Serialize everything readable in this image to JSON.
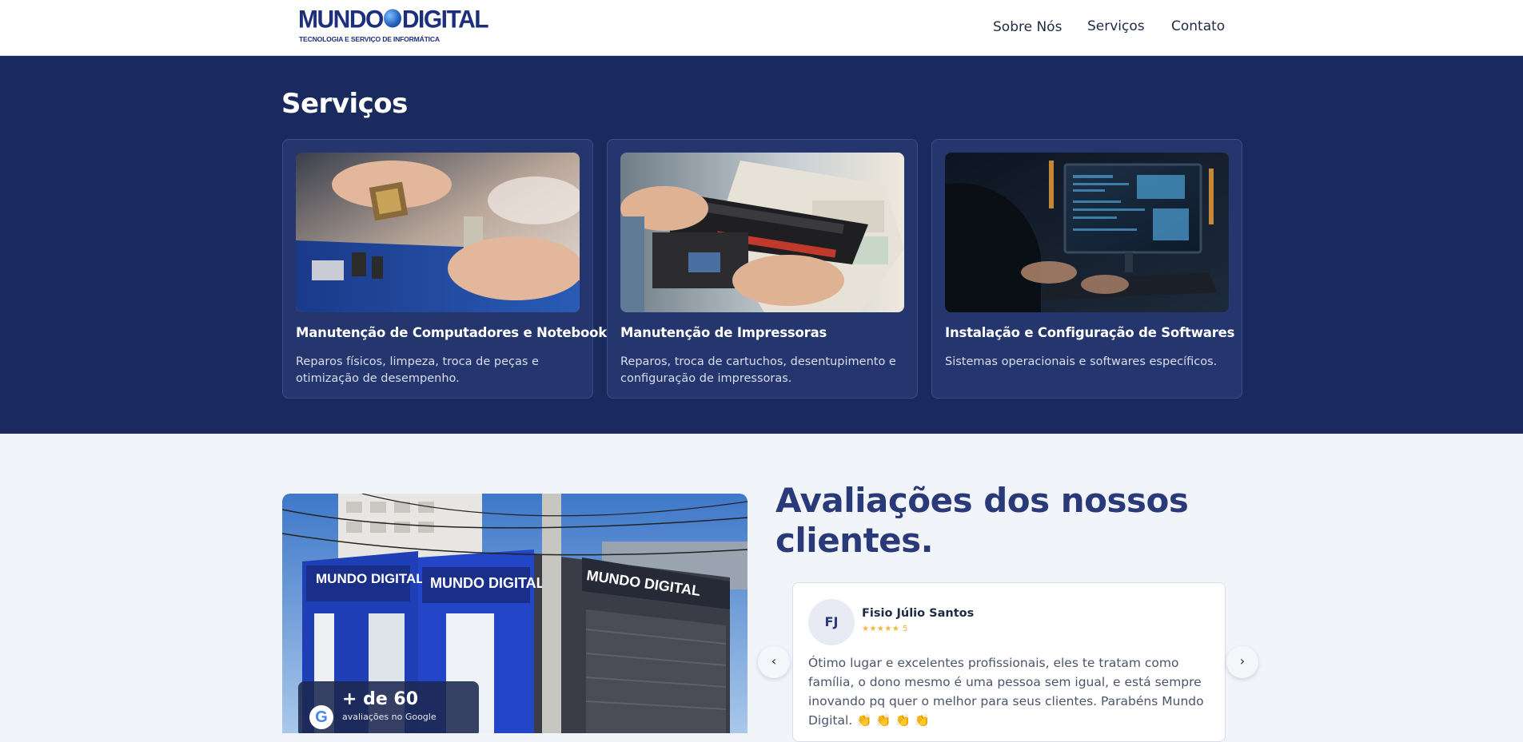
{
  "header": {
    "logo_main": "MUNDO DIGITAL",
    "logo_sub": "TECNOLOGIA E SERVIÇO DE INFORMÁTICA",
    "nav": [
      "Sobre Nós",
      "Serviços",
      "Contato"
    ]
  },
  "services": {
    "title": "Serviços",
    "cards": [
      {
        "title": "Manutenção de Computadores e Notebooks",
        "description": "Reparos físicos, limpeza, troca de peças e otimização de desempenho.",
        "image": "hands-cpu-motherboard-photo"
      },
      {
        "title": "Manutenção de Impressoras",
        "description": "Reparos, troca de cartuchos, desentupimento e configuração de impressoras.",
        "image": "hands-printer-toner-photo"
      },
      {
        "title": "Instalação e Configuração de Softwares",
        "description": "Sistemas operacionais e softwares específicos.",
        "image": "person-at-computer-monitor-photo"
      }
    ]
  },
  "reviews": {
    "title": "Avaliações dos nossos clientes.",
    "badge": {
      "count": "+ de 60",
      "sub": "avaliações no Google",
      "icon": "google-icon"
    },
    "current": {
      "initials": "FJ",
      "name": "Fisio Júlio Santos",
      "rating": "★★★★★ 5",
      "text": "Ótimo lugar e excelentes profissionais, eles te tratam como família, o dono mesmo é uma pessoa sem igual, e está sempre inovando pq quer o melhor para seus clientes. Parabéns Mundo Digital. 👏 👏 👏 👏"
    },
    "prev": "‹",
    "next": "›"
  },
  "colors": {
    "services_bg": "#1a2a5e",
    "card_bg": "#24366d",
    "accent": "#2a3a78",
    "star": "#f2b63a"
  }
}
